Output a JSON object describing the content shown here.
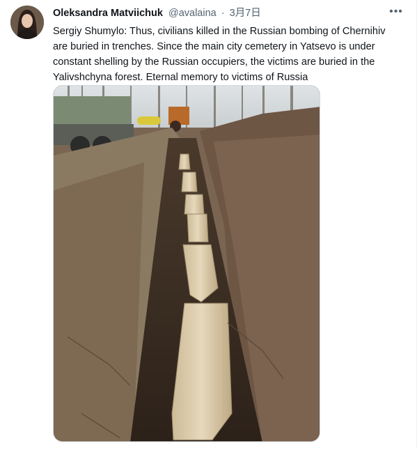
{
  "tweet": {
    "author_name": "Oleksandra Matviichuk",
    "handle": "@avalaina",
    "separator": "·",
    "date": "3月7日",
    "more_icon": "more-horizontal-icon",
    "text": "Sergiy Shumylo: Thus, civilians killed in the Russian bombing of Chernihiv are buried in trenches. Since the main city cemetery in Yatsevo is under constant shelling by the Russian occupiers, the victims are buried in the Yalivshchyna forest. Eternal memory to victims of Russia",
    "colors": {
      "text": "#0f1419",
      "secondary": "#536471",
      "border": "#cfd9de"
    }
  }
}
